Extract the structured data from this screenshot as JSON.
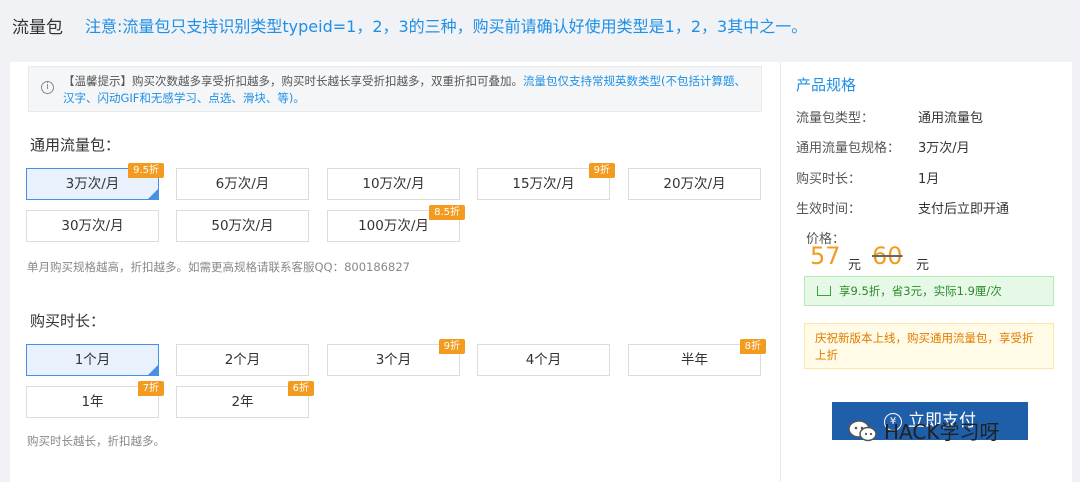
{
  "header": {
    "title": "流量包",
    "notice": "注意:流量包只支持识别类型typeid=1，2，3的三种，购买前请确认好使用类型是1，2，3其中之一。"
  },
  "tip": {
    "text": "【温馨提示】购买次数越多享受折扣越多，购买时长越长享受折扣越多，双重折扣可叠加。",
    "highlight": "流量包仅支持常规英数类型(不包括计算题、汉字、闪动GIF和无感学习、点选、滑块、等)。"
  },
  "package": {
    "title": "通用流量包：",
    "options": [
      {
        "label": "3万次/月",
        "badge": "9.5折",
        "selected": true
      },
      {
        "label": "6万次/月",
        "badge": ""
      },
      {
        "label": "10万次/月",
        "badge": ""
      },
      {
        "label": "15万次/月",
        "badge": "9折"
      },
      {
        "label": "20万次/月",
        "badge": ""
      },
      {
        "label": "30万次/月",
        "badge": ""
      },
      {
        "label": "50万次/月",
        "badge": ""
      },
      {
        "label": "100万次/月",
        "badge": "8.5折"
      }
    ],
    "hint": "单月购买规格越高，折扣越多。如需更高规格请联系客服QQ：800186827"
  },
  "duration": {
    "title": "购买时长：",
    "options": [
      {
        "label": "1个月",
        "badge": "",
        "selected": true
      },
      {
        "label": "2个月",
        "badge": ""
      },
      {
        "label": "3个月",
        "badge": "9折"
      },
      {
        "label": "4个月",
        "badge": ""
      },
      {
        "label": "半年",
        "badge": "8折"
      },
      {
        "label": "1年",
        "badge": "7折"
      },
      {
        "label": "2年",
        "badge": "6折"
      }
    ],
    "hint": "购买时长越长，折扣越多。"
  },
  "spec": {
    "title": "产品规格",
    "rows": [
      {
        "label": "流量包类型：",
        "value": "通用流量包"
      },
      {
        "label": "通用流量包规格：",
        "value": "3万次/月"
      },
      {
        "label": "购买时长：",
        "value": "1月"
      },
      {
        "label": "生效时间：",
        "value": "支付后立即开通"
      }
    ],
    "price_label": "价格：",
    "price_now": "57",
    "price_unit": "元",
    "price_old": "60",
    "price_old_unit": "元",
    "discount_text": "享9.5折，省3元，实际1.9厘/次",
    "promo_text": "庆祝新版本上线，购买通用流量包，享受折上折",
    "pay_label": "立即支付"
  },
  "watermark": {
    "text": "HACK学习呀"
  },
  "colors": {
    "accent": "#1e90e6",
    "badge": "#f29b1f",
    "selected_bg": "#e8f1fc",
    "pay_button": "#1f5ea8"
  }
}
